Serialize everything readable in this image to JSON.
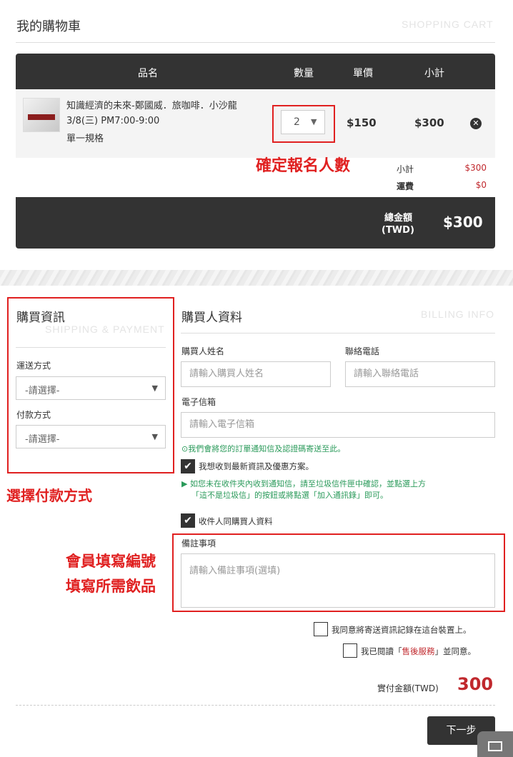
{
  "cart": {
    "title": "我的購物車",
    "title_en": "SHOPPING CART",
    "columns": {
      "name": "品名",
      "qty": "數量",
      "unit_price": "單價",
      "subtotal": "小計"
    },
    "item": {
      "name": "知識經濟的未來-鄭國威．旅咖啡．小沙龍",
      "datetime": "3/8(三) PM7:00-9:00",
      "spec": "單一規格",
      "qty": "2",
      "unit_price": "$150",
      "subtotal": "$300",
      "remove_icon": "✕"
    },
    "summary": {
      "subtotal_label": "小計",
      "subtotal_value": "$300",
      "shipping_label": "運費",
      "shipping_value": "$0",
      "total_label": "總金額",
      "total_currency": "(TWD)",
      "total_value": "$300"
    }
  },
  "annotations": {
    "qty_note": "確定報名人數",
    "payment_note": "選擇付款方式",
    "remark_note_1": "會員填寫編號",
    "remark_note_2": "填寫所需飲品"
  },
  "shipping": {
    "title": "購買資訊",
    "title_en": "SHIPPING & PAYMENT",
    "delivery_label": "運送方式",
    "delivery_value": "-請選擇-",
    "payment_label": "付款方式",
    "payment_value": "-請選擇-"
  },
  "billing": {
    "title": "購買人資料",
    "title_en": "BILLING INFO",
    "name_label": "購買人姓名",
    "name_placeholder": "請輸入購買人姓名",
    "phone_label": "聯絡電話",
    "phone_placeholder": "請輸入聯絡電話",
    "email_label": "電子信箱",
    "email_placeholder": "請輸入電子信箱",
    "email_hint": "我們會將您的訂單通知信及認證碼寄送至此。",
    "subscribe_label": "我想收到最新資訊及優惠方案。",
    "spam_hint_1": "▶ 如您未在收件夾內收到通知信，請至垃圾信件匣中確認，並點選上方",
    "spam_hint_2": "「這不是垃圾信」的按鈕或將點選「加入通訊錄」即可。",
    "same_as_buyer_label": "收件人同購買人資料",
    "remark_label": "備註事項",
    "remark_placeholder": "請輸入備註事項(選填)",
    "remember_label": "我同意將寄送資訊記錄在這台裝置上。",
    "terms_prefix": "我已閱讀「",
    "terms_link": "售後服務",
    "terms_suffix": "」並同意。",
    "amount_label": "實付金額(TWD)",
    "amount_value": "300",
    "next_button": "下一步"
  },
  "colors": {
    "accent_red": "#c0282d",
    "annotation_red": "#e02020",
    "dark": "#333333",
    "green": "#2a9a5a"
  }
}
